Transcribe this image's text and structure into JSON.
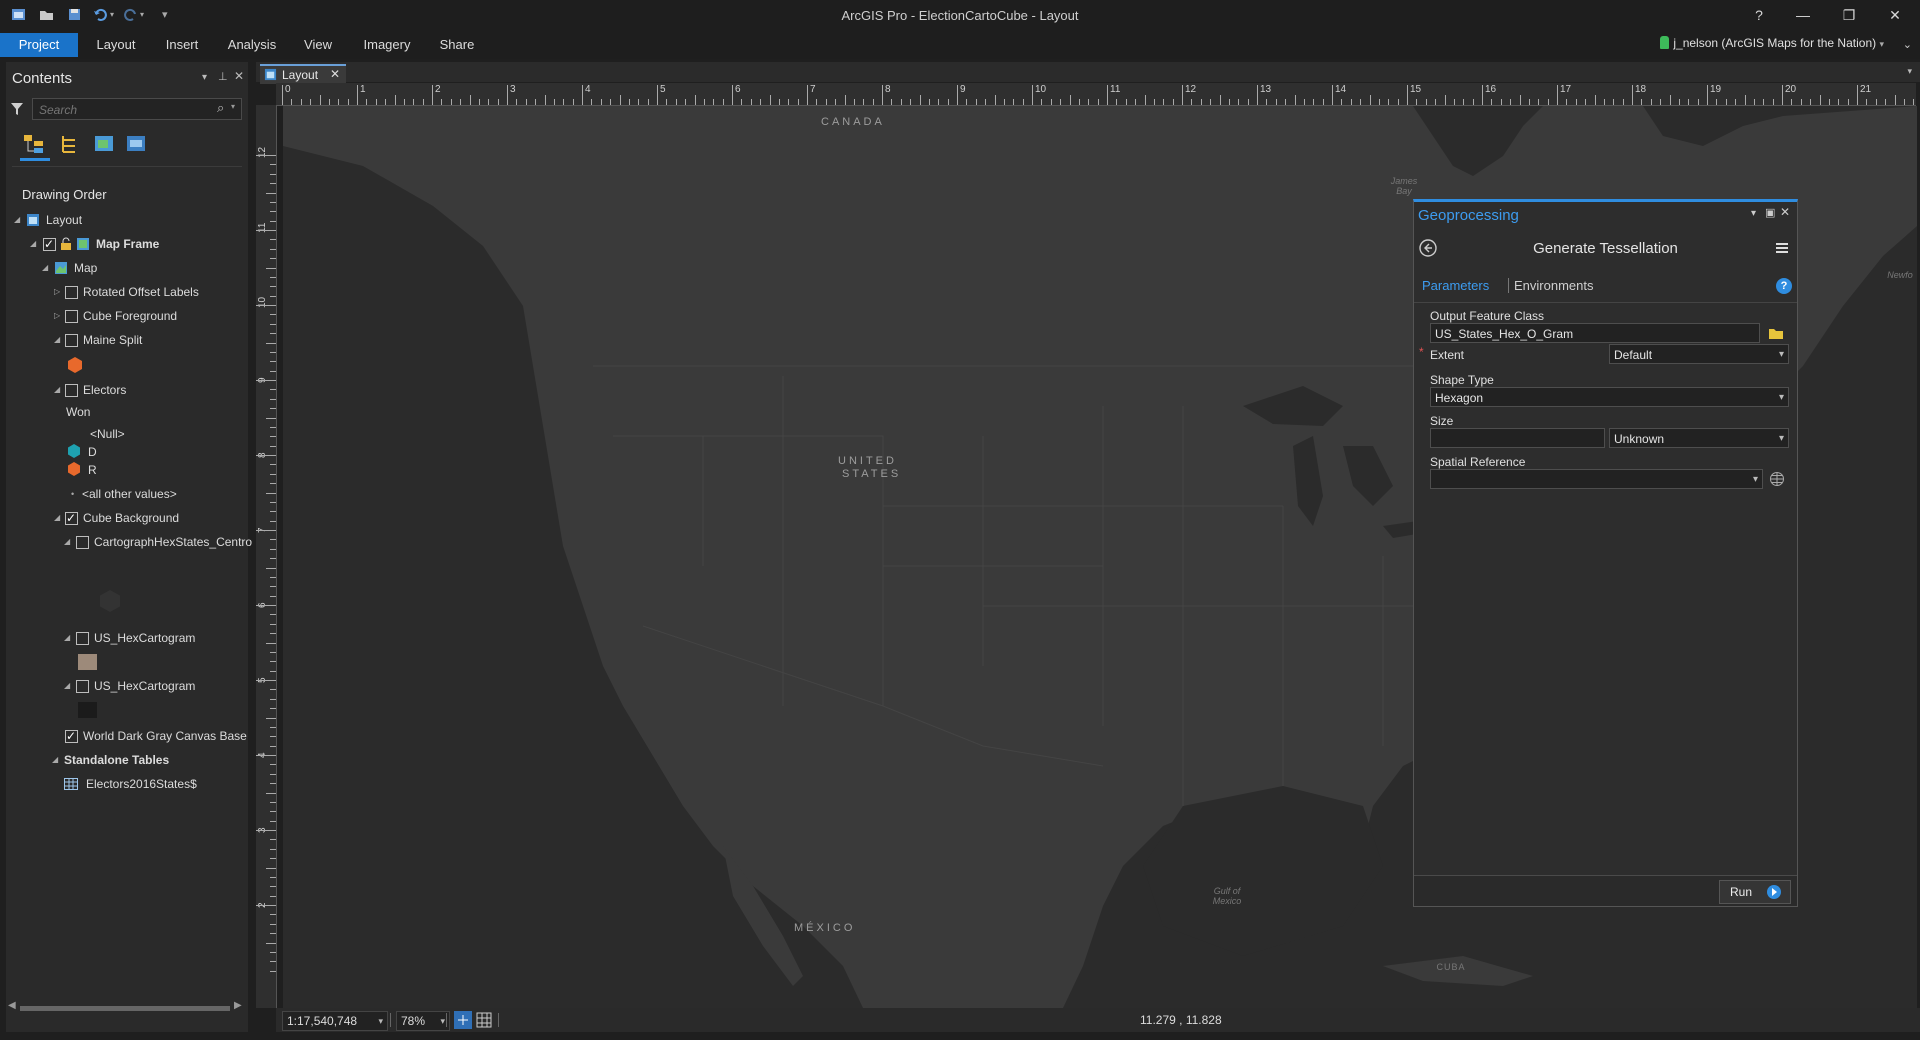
{
  "app": {
    "title": "ArcGIS Pro - ElectionCartoCube - Layout"
  },
  "ribbon": {
    "tabs": [
      {
        "label": "Project"
      },
      {
        "label": "Layout"
      },
      {
        "label": "Insert"
      },
      {
        "label": "Analysis"
      },
      {
        "label": "View"
      },
      {
        "label": "Imagery"
      },
      {
        "label": "Share"
      }
    ],
    "user": "j_nelson (ArcGIS Maps for the Nation)",
    "help": "?"
  },
  "contents": {
    "title": "Contents",
    "search_placeholder": "Search",
    "drawing_order": "Drawing Order",
    "tree": {
      "layout": "Layout",
      "map_frame": "Map Frame",
      "map": "Map",
      "rotated_offset_labels": "Rotated Offset Labels",
      "cube_foreground": "Cube Foreground",
      "maine_split": "Maine Split",
      "electors": "Electors",
      "won": "Won",
      "null": "<Null>",
      "d": "D",
      "r": "R",
      "all_other": "<all other values>",
      "cube_background": "Cube Background",
      "centroids": "CartographHexStates_Centro",
      "hex1": "US_HexCartogram",
      "hex2": "US_HexCartogram",
      "world_dark_gray": "World Dark Gray Canvas Base",
      "standalone_tables": "Standalone Tables",
      "electors_table": "Electors2016States$"
    }
  },
  "view_tab": {
    "label": "Layout"
  },
  "ruler": {
    "h_numbers": [
      "0",
      "1",
      "2",
      "3",
      "4",
      "5",
      "6",
      "7",
      "8",
      "9",
      "10",
      "11",
      "12",
      "13",
      "14",
      "15",
      "16",
      "17",
      "18",
      "19",
      "20",
      "21"
    ],
    "v_numbers": [
      "12",
      "11",
      "10",
      "9",
      "8",
      "7",
      "6",
      "5",
      "4",
      "3",
      "2"
    ]
  },
  "map": {
    "canada": "CANADA",
    "us_line1": "UNITED",
    "us_line2": "STATES",
    "mexico": "MÉXICO",
    "james_bay": "James Bay",
    "gulf": "Gulf of Mexico",
    "cuba": "CUBA",
    "newfo": "Newfo"
  },
  "geoprocessing": {
    "title": "Geoprocessing",
    "tool": "Generate Tessellation",
    "tab_parameters": "Parameters",
    "tab_environments": "Environments",
    "output_label": "Output Feature Class",
    "output_value": "US_States_Hex_O_Gram",
    "extent_label": "Extent",
    "extent_value": "Default",
    "shape_label": "Shape Type",
    "shape_value": "Hexagon",
    "size_label": "Size",
    "size_value": "",
    "size_unit": "Unknown",
    "sr_label": "Spatial Reference",
    "sr_value": "",
    "run": "Run"
  },
  "status": {
    "scale": "1:17,540,748",
    "zoom": "78%",
    "coords": "11.279 , 11.828"
  },
  "colors": {
    "accent": "#1a73c9",
    "gp_title": "#3d9cf0",
    "d_color": "#1ea1b0",
    "r_color": "#e8692c",
    "land": "#3a3a3a",
    "water": "#2b2b2b"
  }
}
